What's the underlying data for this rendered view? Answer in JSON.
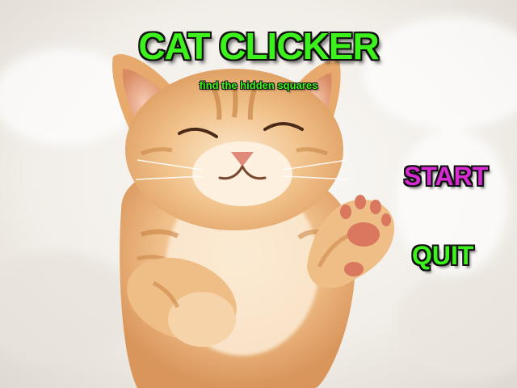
{
  "game": {
    "title": "CAT CLICKER",
    "subtitle": "find the hidden squares"
  },
  "menu": {
    "start_label": "START",
    "quit_label": "QUIT"
  },
  "colors": {
    "title_green": "#3df21c",
    "start_magenta": "#d62bd0",
    "outline": "#111111",
    "fur_orange": "#e8a566",
    "blanket_white": "#f4f1ec"
  },
  "background": {
    "subject": "kitten-photo"
  }
}
